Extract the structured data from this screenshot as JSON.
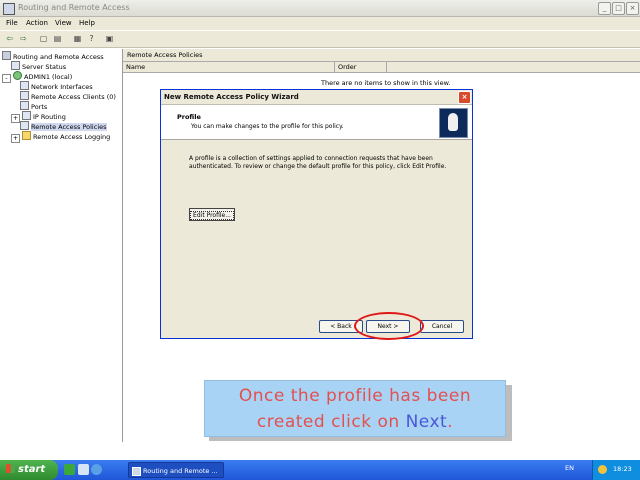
{
  "window": {
    "title": "Routing and Remote Access",
    "controls": [
      "minimize",
      "maximize",
      "close"
    ]
  },
  "menubar": {
    "items": [
      "File",
      "Action",
      "View",
      "Help"
    ]
  },
  "toolbar": {
    "icons": [
      "back-icon",
      "forward-icon",
      "up-icon",
      "show-hide-tree-icon",
      "export-list-icon",
      "help-icon",
      "properties-icon"
    ]
  },
  "tree": {
    "items": [
      {
        "label": "Routing and Remote Access",
        "indent": 0,
        "icon": "server-icon"
      },
      {
        "label": "Server Status",
        "indent": 1,
        "icon": "server-status-icon"
      },
      {
        "label": "ADMIN1 (local)",
        "indent": 1,
        "icon": "server-ok-icon",
        "expander": "-"
      },
      {
        "label": "Network Interfaces",
        "indent": 2,
        "icon": "network-interfaces-icon"
      },
      {
        "label": "Remote Access Clients (0)",
        "indent": 2,
        "icon": "clients-icon"
      },
      {
        "label": "Ports",
        "indent": 2,
        "icon": "ports-icon"
      },
      {
        "label": "IP Routing",
        "indent": 2,
        "icon": "ip-routing-icon",
        "expander": "+"
      },
      {
        "label": "Remote Access Policies",
        "indent": 2,
        "icon": "policies-icon",
        "selected": true
      },
      {
        "label": "Remote Access Logging",
        "indent": 2,
        "icon": "folder-icon",
        "expander": "+"
      }
    ]
  },
  "list": {
    "title": "Remote Access Policies",
    "columns": [
      "Name",
      "Order"
    ],
    "empty_message": "There are no items to show in this view."
  },
  "wizard": {
    "title": "New Remote Access Policy Wizard",
    "heading": "Profile",
    "subheading": "You can make changes to the profile for this policy.",
    "body": "A profile is a collection of settings applied to connection requests that have been authenticated. To review or change the default profile for this policy, click Edit Profile.",
    "edit_profile_label": "Edit Profile...",
    "back_label": "< Back",
    "next_label": "Next >",
    "cancel_label": "Cancel"
  },
  "callout": {
    "line1": "Once the profile has been",
    "line2_prefix": "created click on ",
    "line2_highlight": "Next",
    "line2_suffix": ".",
    "text_color": "#e35050",
    "highlight_color": "#4a56d8",
    "background": "#a9d3f4"
  },
  "taskbar": {
    "start_label": "start",
    "task_label": "Routing and Remote ...",
    "language": "EN",
    "clock": "18:23"
  },
  "colors": {
    "highlight_ring": "#e01818",
    "dialog_border": "#0831d9",
    "taskbar": "#1f56d8"
  }
}
